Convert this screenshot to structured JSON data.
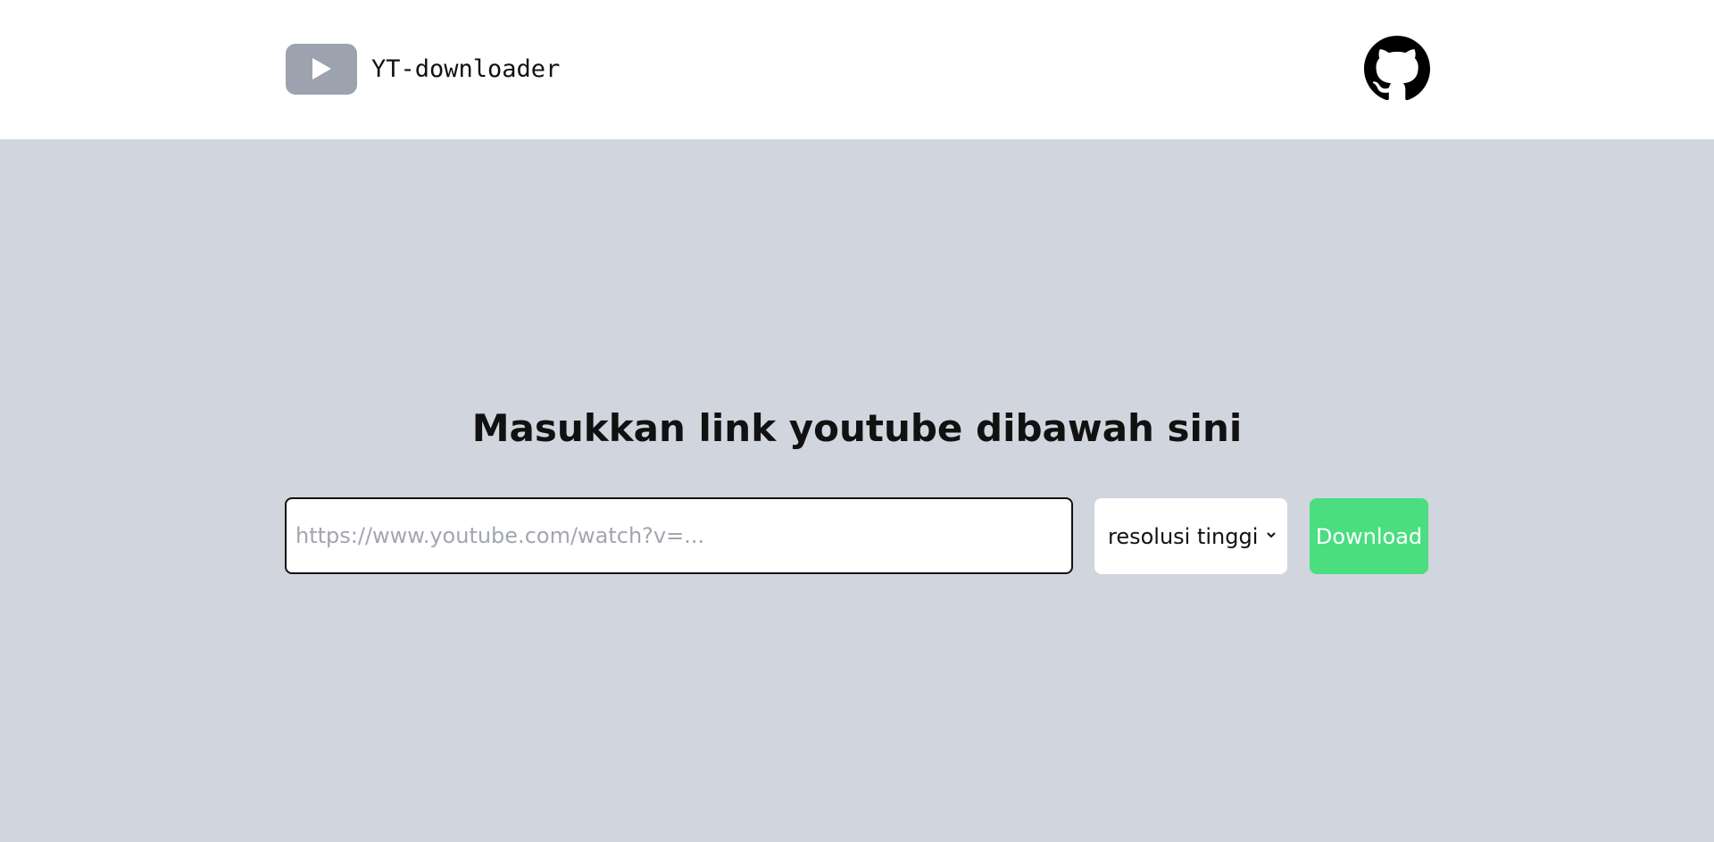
{
  "header": {
    "brand_name": "YT-downloader",
    "logo_icon": "youtube-play-icon",
    "github_icon": "github-icon"
  },
  "main": {
    "title": "Masukkan link youtube dibawah sini",
    "url_input": {
      "value": "",
      "placeholder": "https://www.youtube.com/watch?v=..."
    },
    "resolution_select": {
      "selected": "resolusi tinggi"
    },
    "download_label": "Download"
  },
  "colors": {
    "header_bg": "#ffffff",
    "page_bg": "#d1d5de",
    "logo_bg": "#9da3ae",
    "download_bg": "#4ade80"
  }
}
